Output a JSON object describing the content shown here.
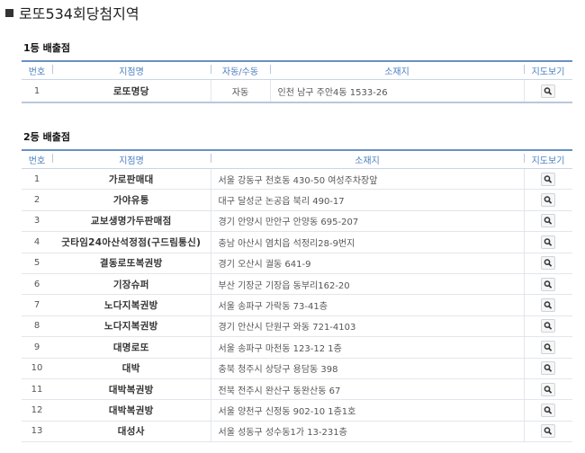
{
  "page_title": "로또534회당첨지역",
  "first_prize": {
    "title": "1등 배출점",
    "headers": [
      "번호",
      "지점명",
      "자동/수동",
      "소재지",
      "지도보기"
    ],
    "rows": [
      {
        "no": "1",
        "name": "로또명당",
        "type": "자동",
        "addr": "인천 남구 주안4동 1533-26"
      }
    ]
  },
  "second_prize": {
    "title": "2등 배출점",
    "headers": [
      "번호",
      "지점명",
      "소재지",
      "지도보기"
    ],
    "rows": [
      {
        "no": "1",
        "name": "가로판매대",
        "addr": "서울 강동구 천호동 430-50 여성주차장앞"
      },
      {
        "no": "2",
        "name": "가야유통",
        "addr": "대구 달성군 논공읍 북리 490-17"
      },
      {
        "no": "3",
        "name": "교보생명가두판매점",
        "addr": "경기 안양시 만안구 안양동 695-207"
      },
      {
        "no": "4",
        "name": "굿타임24아산석정점(구드림통신)",
        "addr": "충남 아산시 염치읍 석정리28-9번지"
      },
      {
        "no": "5",
        "name": "결동로또복권방",
        "addr": "경기 오산시 궐동 641-9"
      },
      {
        "no": "6",
        "name": "기장슈퍼",
        "addr": "부산 기장군 기장읍 동부리162-20"
      },
      {
        "no": "7",
        "name": "노다지복권방",
        "addr": "서울 송파구 가락동 73-41층"
      },
      {
        "no": "8",
        "name": "노다지복권방",
        "addr": "경기 안산시 단원구 와동 721-4103"
      },
      {
        "no": "9",
        "name": "대명로또",
        "addr": "서울 송파구 마천동 123-12 1층"
      },
      {
        "no": "10",
        "name": "대박",
        "addr": "충북 청주시 상당구 용담동 398"
      },
      {
        "no": "11",
        "name": "대박복권방",
        "addr": "전북 전주시 완산구 동완산동 67"
      },
      {
        "no": "12",
        "name": "대박복권방",
        "addr": "서울 양천구 신정동 902-10 1층1호"
      },
      {
        "no": "13",
        "name": "대성사",
        "addr": "서울 성동구 성수동1가 13-231층"
      }
    ]
  },
  "icons": {
    "map": "magnifier-icon"
  },
  "colors": {
    "header_text": "#4a7fc1",
    "header_line": "#6a8fc4"
  }
}
